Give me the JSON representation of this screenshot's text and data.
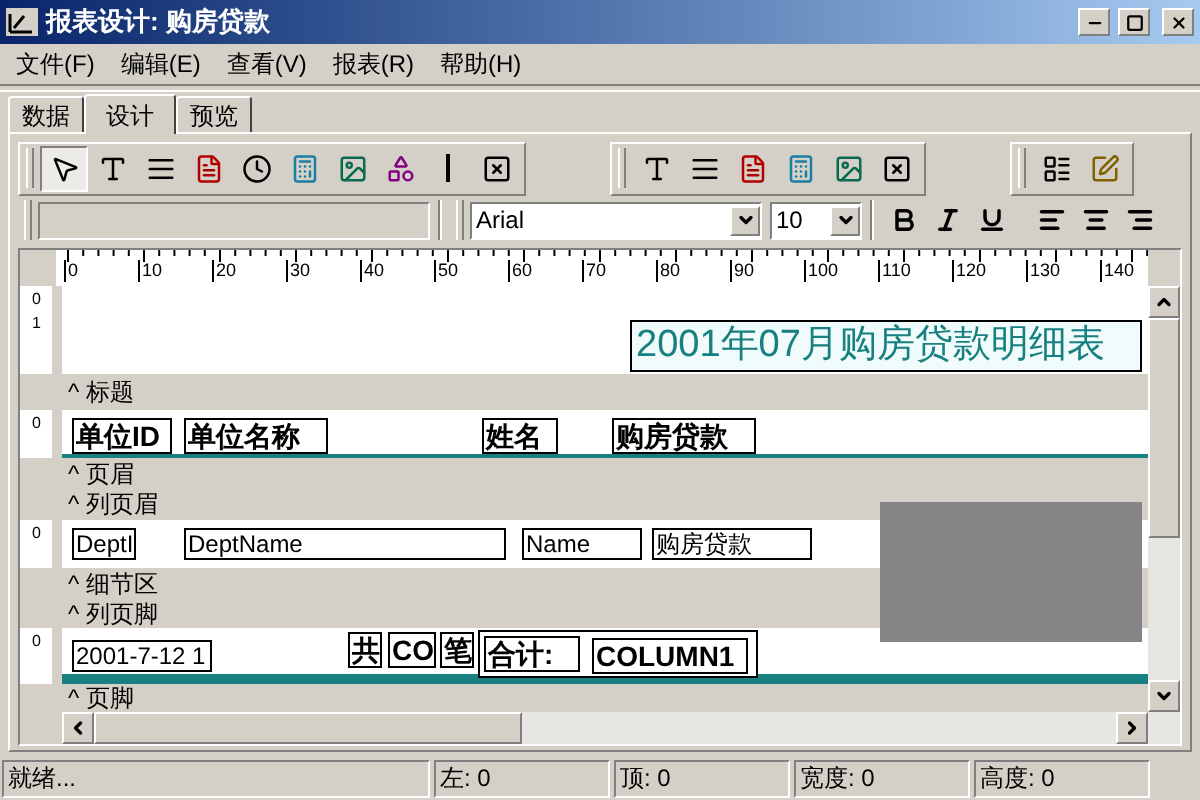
{
  "window": {
    "title": "报表设计: 购房贷款"
  },
  "menu": [
    "文件(F)",
    "编辑(E)",
    "查看(V)",
    "报表(R)",
    "帮助(H)"
  ],
  "tabs": [
    {
      "label": "数据",
      "selected": false
    },
    {
      "label": "设计",
      "selected": true
    },
    {
      "label": "预览",
      "selected": false
    }
  ],
  "tools": [
    {
      "kind": "pointer",
      "selected": true
    },
    {
      "kind": "text",
      "selected": false
    },
    {
      "kind": "memo",
      "selected": false
    },
    {
      "kind": "rich",
      "selected": false
    },
    {
      "kind": "clock",
      "selected": false
    },
    {
      "kind": "calc",
      "selected": false
    },
    {
      "kind": "image",
      "selected": false
    },
    {
      "kind": "shape",
      "selected": false
    },
    {
      "kind": "line",
      "selected": false
    },
    {
      "kind": "delete",
      "selected": false
    }
  ],
  "tools_2": [
    {
      "kind": "text"
    },
    {
      "kind": "memo"
    },
    {
      "kind": "rich"
    },
    {
      "kind": "calc"
    },
    {
      "kind": "image"
    },
    {
      "kind": "delete"
    }
  ],
  "tools_3": [
    {
      "kind": "grid"
    },
    {
      "kind": "edit"
    }
  ],
  "format_bar": {
    "font": "Arial",
    "size": "10"
  },
  "ruler": [
    "0",
    "10",
    "20",
    "30",
    "40",
    "50",
    "60",
    "70",
    "80",
    "90",
    "100",
    "110",
    "120",
    "130",
    "140"
  ],
  "rows": [
    {
      "kind": "band",
      "gutter": [
        "0",
        "1"
      ],
      "items": [
        {
          "kind": "title",
          "text": "2001年07月购房贷款明细表"
        }
      ]
    },
    {
      "kind": "section",
      "label": "^ 标题"
    },
    {
      "kind": "band",
      "gutter": [
        "0"
      ],
      "items": [
        {
          "kind": "header",
          "text": "单位ID"
        },
        {
          "kind": "header",
          "text": "单位名称"
        },
        {
          "kind": "header",
          "text": "姓名"
        },
        {
          "kind": "header",
          "text": "购房贷款"
        }
      ]
    },
    {
      "kind": "section",
      "label": "^ 页眉"
    },
    {
      "kind": "section",
      "label": "^ 列页眉"
    },
    {
      "kind": "band",
      "gutter": [
        "0"
      ],
      "items": [
        {
          "kind": "field",
          "text": "DeptI"
        },
        {
          "kind": "field",
          "text": "DeptName"
        },
        {
          "kind": "field",
          "text": "Name"
        },
        {
          "kind": "field",
          "text": "购房贷款"
        }
      ]
    },
    {
      "kind": "section",
      "label": "^ 细节区"
    },
    {
      "kind": "section",
      "label": "^ 列页脚"
    },
    {
      "kind": "band",
      "gutter": [
        "0"
      ],
      "items": [
        {
          "kind": "field",
          "text": "2001-7-12 1"
        },
        {
          "kind": "header",
          "text": "共"
        },
        {
          "kind": "header",
          "text": "CO"
        },
        {
          "kind": "header",
          "text": "笔"
        },
        {
          "kind": "frame"
        },
        {
          "kind": "header",
          "text": "合计:"
        },
        {
          "kind": "header",
          "text": "COLUMN1"
        }
      ]
    },
    {
      "kind": "section",
      "label": "^ 页脚"
    }
  ],
  "status_bar": [
    "就绪...",
    "左: 0",
    "顶: 0",
    "宽度: 0",
    "高度: 0"
  ]
}
